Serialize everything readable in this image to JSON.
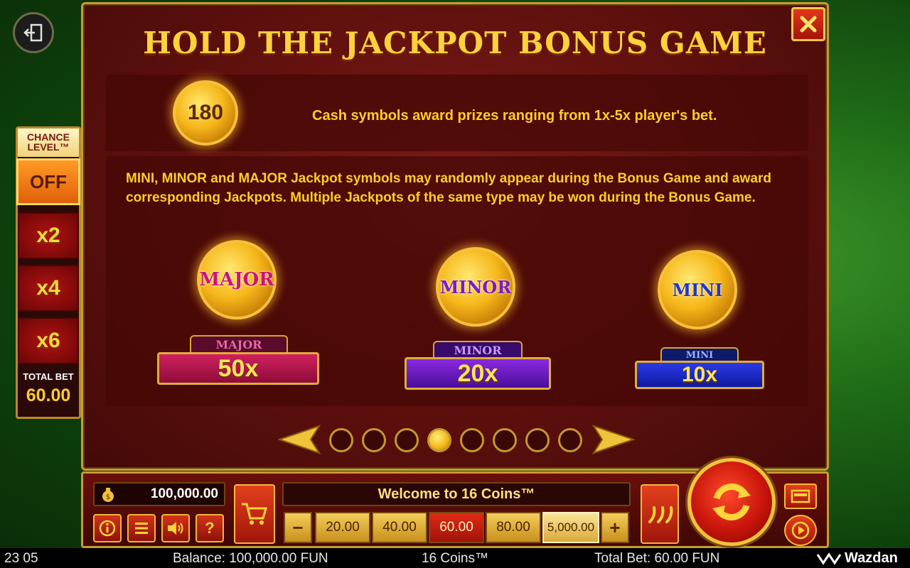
{
  "title": "HOLD THE JACKPOT BONUS GAME",
  "cash_coin_value": "180",
  "cash_text": "Cash symbols award prizes ranging from 1x-5x player's bet.",
  "jackpot_text": "MINI, MINOR and MAJOR Jackpot symbols may randomly appear during the Bonus Game and award corresponding Jackpots. Multiple Jackpots of the same type may be won during the Bonus Game.",
  "jackpots": [
    {
      "coin_label": "MAJOR",
      "tag": "MAJOR",
      "value": "50x",
      "color": "#b8124a"
    },
    {
      "coin_label": "MINOR",
      "tag": "MINOR",
      "value": "20x",
      "color": "#6a1ab8"
    },
    {
      "coin_label": "MINI",
      "tag": "MINI",
      "value": "10x",
      "color": "#1a2ab0"
    }
  ],
  "pagination": {
    "total": 8,
    "active": 4
  },
  "chance_level": {
    "title_line1": "CHANCE",
    "title_line2": "LEVEL™",
    "options": [
      "OFF",
      "x2",
      "x4",
      "x6"
    ],
    "selected": "OFF",
    "total_bet_label": "TOTAL BET",
    "total_bet_value": "60.00"
  },
  "bottom": {
    "balance": "100,000.00",
    "welcome": "Welcome to 16 Coins™",
    "bets": [
      "20.00",
      "40.00",
      "60.00",
      "80.00",
      "5,000.00"
    ],
    "selected_bet": "60.00",
    "minus": "−",
    "plus": "+",
    "help": "?"
  },
  "status": {
    "time": "23 05",
    "balance": "Balance: 100,000.00 FUN",
    "game": "16 Coins™",
    "total_bet": "Total Bet: 60.00 FUN",
    "brand": "Wazdan"
  },
  "colors": {
    "accent_gold": "#ffcc2a",
    "panel_red": "#5a0f0c",
    "felt_green": "#1f6a17"
  }
}
